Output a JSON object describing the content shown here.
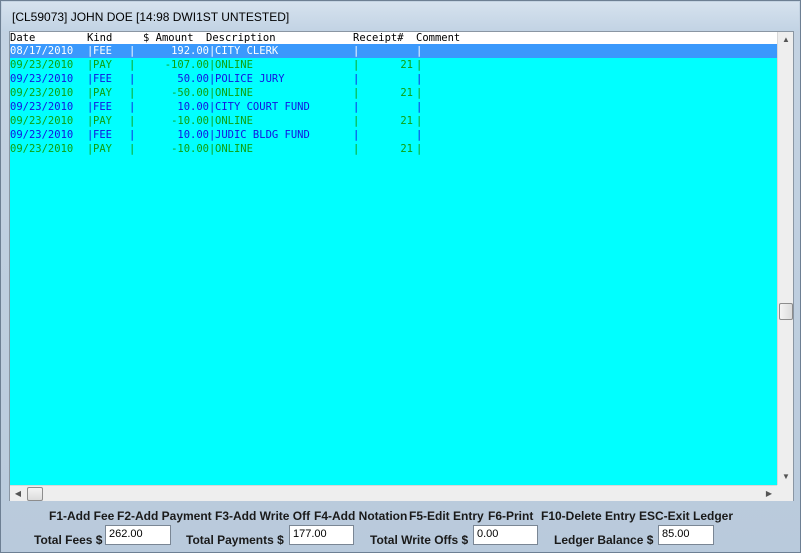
{
  "window": {
    "title": "[CL59073] JOHN DOE  [14:98 DWI1ST UNTESTED]"
  },
  "colors": {
    "grid_bg": "#00ffff",
    "fee": "#1414e0",
    "pay": "#0fa00f",
    "selected": "#3b99fc"
  },
  "columns": {
    "date": "Date",
    "kind": "Kind",
    "amount": "$ Amount",
    "description": "Description",
    "receipt": "Receipt#",
    "comment": "Comment"
  },
  "ledger": [
    {
      "date": "08/17/2010",
      "kind": "FEE",
      "amount": "192.00",
      "description": "CITY CLERK",
      "receipt": "",
      "comment": "",
      "type": "fee",
      "selected": true
    },
    {
      "date": "09/23/2010",
      "kind": "PAY",
      "amount": "-107.00",
      "description": "ONLINE",
      "receipt": "21",
      "comment": "",
      "type": "pay"
    },
    {
      "date": "09/23/2010",
      "kind": "FEE",
      "amount": "50.00",
      "description": "POLICE JURY",
      "receipt": "",
      "comment": "",
      "type": "fee"
    },
    {
      "date": "09/23/2010",
      "kind": "PAY",
      "amount": "-50.00",
      "description": "ONLINE",
      "receipt": "21",
      "comment": "",
      "type": "pay"
    },
    {
      "date": "09/23/2010",
      "kind": "FEE",
      "amount": "10.00",
      "description": "CITY COURT FUND",
      "receipt": "",
      "comment": "",
      "type": "fee"
    },
    {
      "date": "09/23/2010",
      "kind": "PAY",
      "amount": "-10.00",
      "description": "ONLINE",
      "receipt": "21",
      "comment": "",
      "type": "pay"
    },
    {
      "date": "09/23/2010",
      "kind": "FEE",
      "amount": "10.00",
      "description": "JUDIC BLDG FUND",
      "receipt": "",
      "comment": "",
      "type": "fee"
    },
    {
      "date": "09/23/2010",
      "kind": "PAY",
      "amount": "-10.00",
      "description": "ONLINE",
      "receipt": "21",
      "comment": "",
      "type": "pay"
    }
  ],
  "function_keys": {
    "f1": "F1-Add Fee",
    "f2": "F2-Add Payment",
    "f3": "F3-Add Write Off",
    "f4": "F4-Add Notation",
    "f5": "F5-Edit Entry",
    "f6": "F6-Print",
    "f10": "F10-Delete Entry",
    "esc": "ESC-Exit Ledger"
  },
  "totals": {
    "fees_label": "Total Fees $",
    "fees_value": "262.00",
    "payments_label": "Total Payments $",
    "payments_value": "177.00",
    "writeoffs_label": "Total Write Offs $",
    "writeoffs_value": "0.00",
    "balance_label": "Ledger Balance $",
    "balance_value": "85.00"
  }
}
